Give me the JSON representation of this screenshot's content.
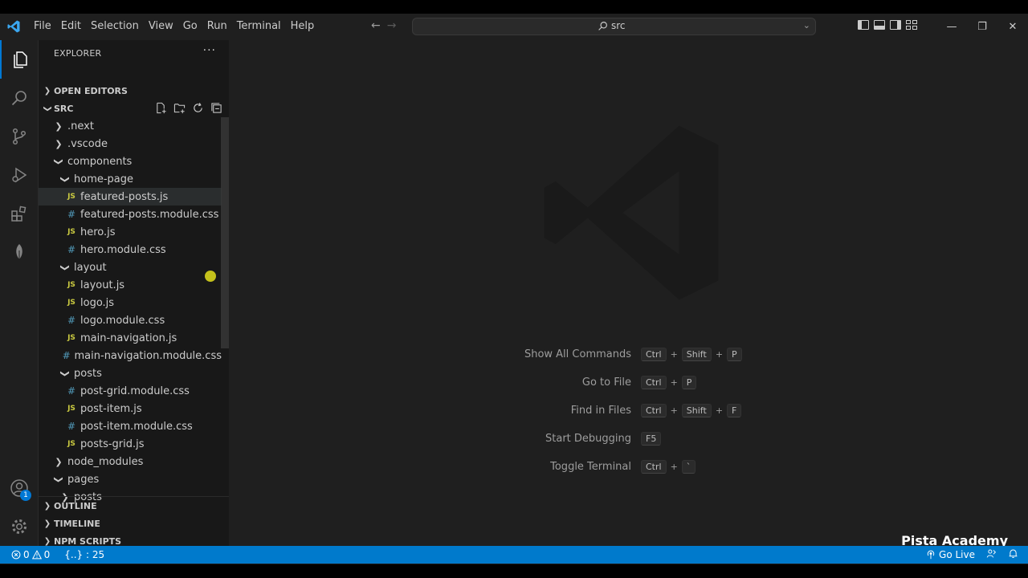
{
  "menu": [
    "File",
    "Edit",
    "Selection",
    "View",
    "Go",
    "Run",
    "Terminal",
    "Help"
  ],
  "command_center": {
    "label": "src"
  },
  "explorer": {
    "title": "EXPLORER",
    "open_editors": "OPEN EDITORS",
    "src": "SRC",
    "tree": [
      {
        "name": ".next",
        "type": "folder",
        "open": false,
        "depth": 1
      },
      {
        "name": ".vscode",
        "type": "folder",
        "open": false,
        "depth": 1
      },
      {
        "name": "components",
        "type": "folder",
        "open": true,
        "depth": 1
      },
      {
        "name": "home-page",
        "type": "folder",
        "open": true,
        "depth": 2
      },
      {
        "name": "featured-posts.js",
        "type": "js",
        "depth": 3,
        "selected": true
      },
      {
        "name": "featured-posts.module.css",
        "type": "css",
        "depth": 3
      },
      {
        "name": "hero.js",
        "type": "js",
        "depth": 3
      },
      {
        "name": "hero.module.css",
        "type": "css",
        "depth": 3
      },
      {
        "name": "layout",
        "type": "folder",
        "open": true,
        "depth": 2
      },
      {
        "name": "layout.js",
        "type": "js",
        "depth": 3
      },
      {
        "name": "logo.js",
        "type": "js",
        "depth": 3
      },
      {
        "name": "logo.module.css",
        "type": "css",
        "depth": 3
      },
      {
        "name": "main-navigation.js",
        "type": "js",
        "depth": 3
      },
      {
        "name": "main-navigation.module.css",
        "type": "css",
        "depth": 3
      },
      {
        "name": "posts",
        "type": "folder",
        "open": true,
        "depth": 2
      },
      {
        "name": "post-grid.module.css",
        "type": "css",
        "depth": 3
      },
      {
        "name": "post-item.js",
        "type": "js",
        "depth": 3
      },
      {
        "name": "post-item.module.css",
        "type": "css",
        "depth": 3
      },
      {
        "name": "posts-grid.js",
        "type": "js",
        "depth": 3
      },
      {
        "name": "node_modules",
        "type": "folder",
        "open": false,
        "depth": 1
      },
      {
        "name": "pages",
        "type": "folder",
        "open": true,
        "depth": 1
      },
      {
        "name": "posts",
        "type": "folder",
        "open": false,
        "depth": 2
      }
    ],
    "outline": "OUTLINE",
    "timeline": "TIMELINE",
    "npm_scripts": "NPM SCRIPTS"
  },
  "shortcuts": [
    {
      "label": "Show All Commands",
      "keys": [
        "Ctrl",
        "Shift",
        "P"
      ]
    },
    {
      "label": "Go to File",
      "keys": [
        "Ctrl",
        "P"
      ]
    },
    {
      "label": "Find in Files",
      "keys": [
        "Ctrl",
        "Shift",
        "F"
      ]
    },
    {
      "label": "Start Debugging",
      "keys": [
        "F5"
      ]
    },
    {
      "label": "Toggle Terminal",
      "keys": [
        "Ctrl",
        "`"
      ]
    }
  ],
  "brand": "Pista Academy",
  "status": {
    "errors": "0",
    "warnings": "0",
    "position": "{..} : 25",
    "go_live": "Go Live"
  },
  "account_badge": "1",
  "colors": {
    "accent": "#0078d4",
    "statusbar": "#007acc",
    "js_icon": "#cbcb41",
    "css_icon": "#519aba"
  }
}
